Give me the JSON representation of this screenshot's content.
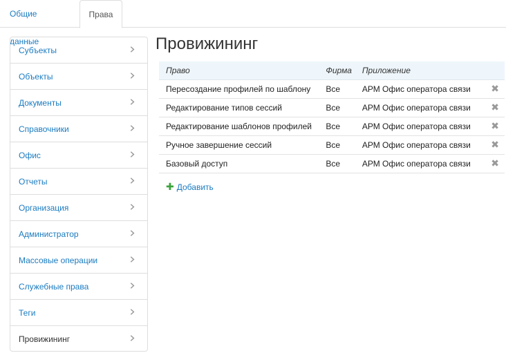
{
  "tabs": [
    {
      "label": "Общие данные",
      "active": false
    },
    {
      "label": "Права",
      "active": true
    }
  ],
  "sidebar": {
    "items": [
      {
        "label": "Субъекты"
      },
      {
        "label": "Объекты"
      },
      {
        "label": "Документы"
      },
      {
        "label": "Справочники"
      },
      {
        "label": "Офис"
      },
      {
        "label": "Отчеты"
      },
      {
        "label": "Организация"
      },
      {
        "label": "Администратор"
      },
      {
        "label": "Массовые операции"
      },
      {
        "label": "Служебные права"
      },
      {
        "label": "Теги"
      },
      {
        "label": "Провижининг",
        "active": true
      }
    ]
  },
  "main": {
    "title": "Провижининг",
    "table": {
      "headers": [
        "Право",
        "Фирма",
        "Приложение"
      ],
      "rows": [
        [
          "Пересоздание профилей по шаблону",
          "Все",
          "АРМ Офис оператора связи"
        ],
        [
          "Редактирование типов сессий",
          "Все",
          "АРМ Офис оператора связи"
        ],
        [
          "Редактирование шаблонов профилей",
          "Все",
          "АРМ Офис оператора связи"
        ],
        [
          "Ручное завершение сессий",
          "Все",
          "АРМ Офис оператора связи"
        ],
        [
          "Базовый доступ",
          "Все",
          "АРМ Офис оператора связи"
        ]
      ],
      "delete_icon": "close-icon"
    },
    "add_label": "Добавить"
  },
  "colors": {
    "link": "#1a7bc0",
    "add_plus": "#3aa33a",
    "header_bg": "#eef6fb"
  }
}
